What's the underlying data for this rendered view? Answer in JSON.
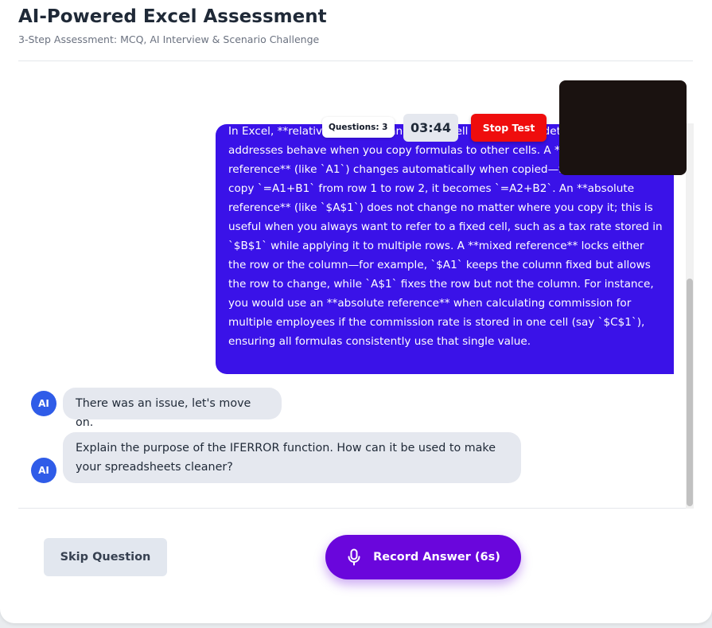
{
  "header": {
    "title": "AI-Powered Excel Assessment",
    "subtitle": "3-Step Assessment: MCQ, AI Interview & Scenario Challenge"
  },
  "chat": {
    "user_message": "In Excel, **relative, absolute, and mixed cell references** determine how cell addresses behave when you copy formulas to other cells. A **relative reference** (like `A1`) changes automatically when copied—for example, if you copy `=A1+B1` from row 1 to row 2, it becomes `=A2+B2`. An **absolute reference** (like `$A$1`) does not change no matter where you copy it; this is useful when you always want to refer to a fixed cell, such as a tax rate stored in `$B$1` while applying it to multiple rows. A **mixed reference** locks either the row or the column—for example, `$A1` keeps the column fixed but allows the row to change, while `A$1` fixes the row but not the column. For instance, you would use an **absolute reference** when calculating commission for multiple employees if the commission rate is stored in one cell (say `$C$1`), ensuring all formulas consistently use that single value.",
    "ai_messages": [
      {
        "avatar": "AI",
        "text": "There was an issue, let's move on."
      },
      {
        "avatar": "AI",
        "text": "Explain the purpose of the IFERROR function. How can it be used to make your spreadsheets cleaner?"
      }
    ]
  },
  "status": {
    "questions_label": "Questions: 3",
    "timer": "03:44",
    "stop_label": "Stop Test"
  },
  "actions": {
    "skip_label": "Skip Question",
    "record_label": "Record Answer (6s)",
    "mic_icon": "microphone-icon"
  },
  "colors": {
    "user_bubble": "#3a12e8",
    "record_button": "#6a06dc",
    "stop_button": "#ef0d0d",
    "avatar": "#2f5ce8"
  }
}
